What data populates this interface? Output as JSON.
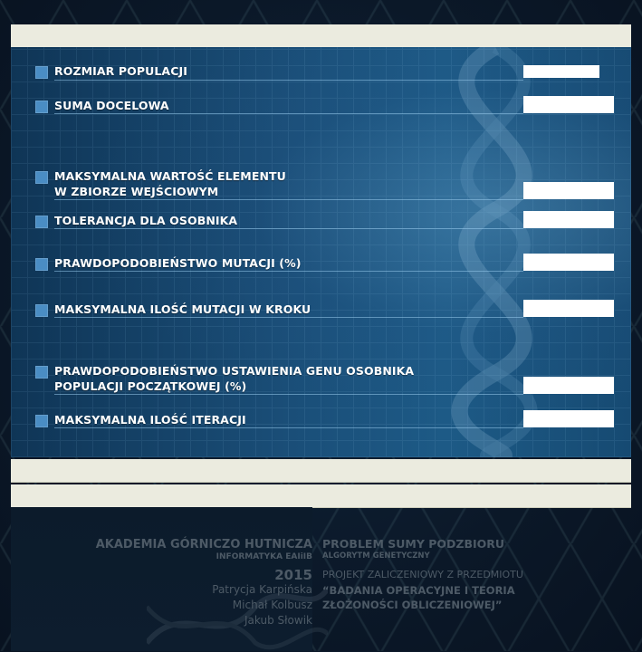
{
  "form": {
    "fields": [
      {
        "label_lines": [
          "ROZMIAR POPULACJI"
        ],
        "value": ""
      },
      {
        "label_lines": [
          "SUMA DOCELOWA"
        ],
        "value": ""
      },
      {
        "label_lines": [
          "MAKSYMALNA WARTOŚĆ ELEMENTU",
          "W ZBIORZE WEJŚCIOWYM"
        ],
        "value": ""
      },
      {
        "label_lines": [
          "TOLERANCJA DLA OSOBNIKA"
        ],
        "value": ""
      },
      {
        "label_lines": [
          "PRAWDOPODOBIEŃSTWO MUTACJI (%)"
        ],
        "value": ""
      },
      {
        "label_lines": [
          "MAKSYMALNA ILOŚĆ MUTACJI W KROKU"
        ],
        "value": ""
      },
      {
        "label_lines": [
          "PRAWDOPODOBIEŃSTWO USTAWIENIA GENU OSOBNIKA",
          "POPULACJI POCZĄTKOWEJ (%)"
        ],
        "value": ""
      },
      {
        "label_lines": [
          "MAKSYMALNA ILOŚĆ ITERACJI"
        ],
        "value": ""
      }
    ]
  },
  "footer": {
    "academy": "AKADEMIA GÓRNICZO HUTNICZA",
    "faculty": "INFORMATYKA EAIiIB",
    "year": "2015",
    "authors": [
      "Patrycja Karpińska",
      "Michał Kolbusz",
      "Jakub Słowik"
    ],
    "project_title": "PROBLEM SUMY PODZBIORU",
    "project_subtitle": "ALGORYTM GENETYCZNY",
    "project_line1": "PROJEKT ZALICZENIOWY Z PRZEDMIOTU",
    "project_line2": "“BADANIA OPERACYJNE I TEORIA",
    "project_line3": "ZŁOŻONOŚCI OBLICZENIOWEJ”"
  },
  "colors": {
    "bar": "#ebebdf",
    "panel": "#1a4e78",
    "bullet": "#4a8dc4",
    "field": "#ffffff",
    "footer_text": "#4d5a66"
  }
}
